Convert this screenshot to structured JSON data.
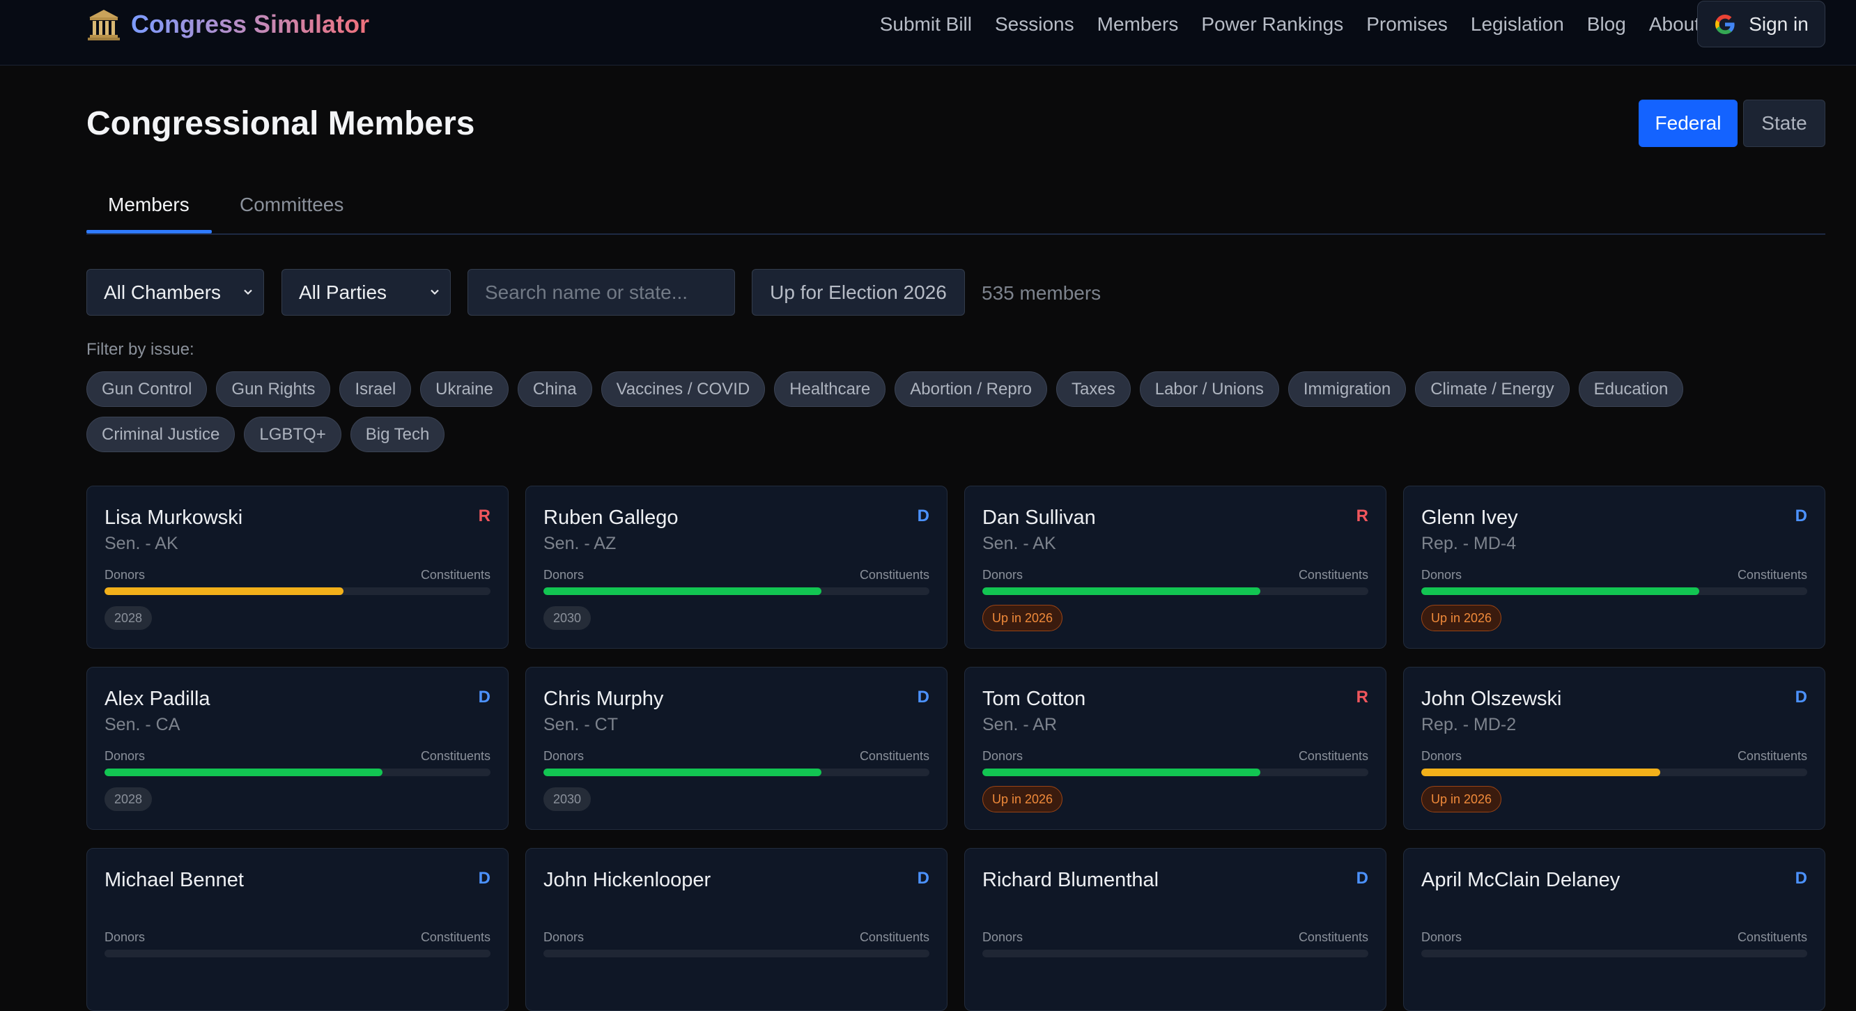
{
  "header": {
    "brand": "Congress Simulator",
    "nav": [
      "Submit Bill",
      "Sessions",
      "Members",
      "Power Rankings",
      "Promises",
      "Legislation",
      "Blog",
      "About"
    ],
    "sign_in": "Sign in"
  },
  "page": {
    "title": "Congressional Members",
    "scope_federal": "Federal",
    "scope_state": "State"
  },
  "tabs": {
    "members": "Members",
    "committees": "Committees"
  },
  "filters": {
    "chambers": "All Chambers",
    "parties": "All Parties",
    "search_placeholder": "Search name or state...",
    "election_button": "Up for Election 2026",
    "member_count": "535 members",
    "issue_label": "Filter by issue:",
    "issues": [
      "Gun Control",
      "Gun Rights",
      "Israel",
      "Ukraine",
      "China",
      "Vaccines / COVID",
      "Healthcare",
      "Abortion / Repro",
      "Taxes",
      "Labor / Unions",
      "Immigration",
      "Climate / Energy",
      "Education",
      "Criminal Justice",
      "LGBTQ+",
      "Big Tech"
    ]
  },
  "card_labels": {
    "donors": "Donors",
    "constituents": "Constituents"
  },
  "members": [
    {
      "name": "Lisa Murkowski",
      "seat": "Sen. - AK",
      "party": "R",
      "alignment": 62,
      "bar_color": "amber",
      "tag": "2028",
      "tag_type": "year"
    },
    {
      "name": "Ruben Gallego",
      "seat": "Sen. - AZ",
      "party": "D",
      "alignment": 72,
      "bar_color": "green",
      "tag": "2030",
      "tag_type": "year"
    },
    {
      "name": "Dan Sullivan",
      "seat": "Sen. - AK",
      "party": "R",
      "alignment": 72,
      "bar_color": "green",
      "tag": "Up in 2026",
      "tag_type": "up"
    },
    {
      "name": "Glenn Ivey",
      "seat": "Rep. - MD-4",
      "party": "D",
      "alignment": 72,
      "bar_color": "green",
      "tag": "Up in 2026",
      "tag_type": "up"
    },
    {
      "name": "Alex Padilla",
      "seat": "Sen. - CA",
      "party": "D",
      "alignment": 72,
      "bar_color": "green",
      "tag": "2028",
      "tag_type": "year"
    },
    {
      "name": "Chris Murphy",
      "seat": "Sen. - CT",
      "party": "D",
      "alignment": 72,
      "bar_color": "green",
      "tag": "2030",
      "tag_type": "year"
    },
    {
      "name": "Tom Cotton",
      "seat": "Sen. - AR",
      "party": "R",
      "alignment": 72,
      "bar_color": "green",
      "tag": "Up in 2026",
      "tag_type": "up"
    },
    {
      "name": "John Olszewski",
      "seat": "Rep. - MD-2",
      "party": "D",
      "alignment": 62,
      "bar_color": "amber",
      "tag": "Up in 2026",
      "tag_type": "up"
    },
    {
      "name": "Michael Bennet",
      "seat": "",
      "party": "D",
      "alignment": 0,
      "bar_color": "green",
      "tag": "",
      "tag_type": "none"
    },
    {
      "name": "John Hickenlooper",
      "seat": "",
      "party": "D",
      "alignment": 0,
      "bar_color": "green",
      "tag": "",
      "tag_type": "none"
    },
    {
      "name": "Richard Blumenthal",
      "seat": "",
      "party": "D",
      "alignment": 0,
      "bar_color": "green",
      "tag": "",
      "tag_type": "none"
    },
    {
      "name": "April McClain Delaney",
      "seat": "",
      "party": "D",
      "alignment": 0,
      "bar_color": "green",
      "tag": "",
      "tag_type": "none"
    }
  ]
}
